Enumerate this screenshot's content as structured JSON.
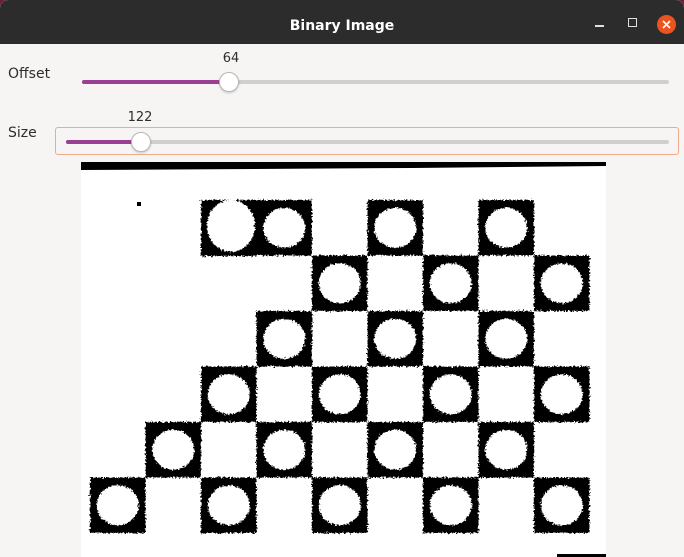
{
  "window": {
    "title": "Binary Image"
  },
  "controls": {
    "offset": {
      "label": "Offset",
      "value": "64",
      "fraction": 0.25
    },
    "size": {
      "label": "Size",
      "value": "122",
      "fraction": 0.125
    }
  },
  "icons": {
    "minimize": "minimize-icon",
    "maximize": "maximize-icon",
    "close": "close-icon"
  },
  "colors": {
    "accent": "#9b3f93",
    "close": "#e95420",
    "titlebar": "#2c2c2c"
  }
}
